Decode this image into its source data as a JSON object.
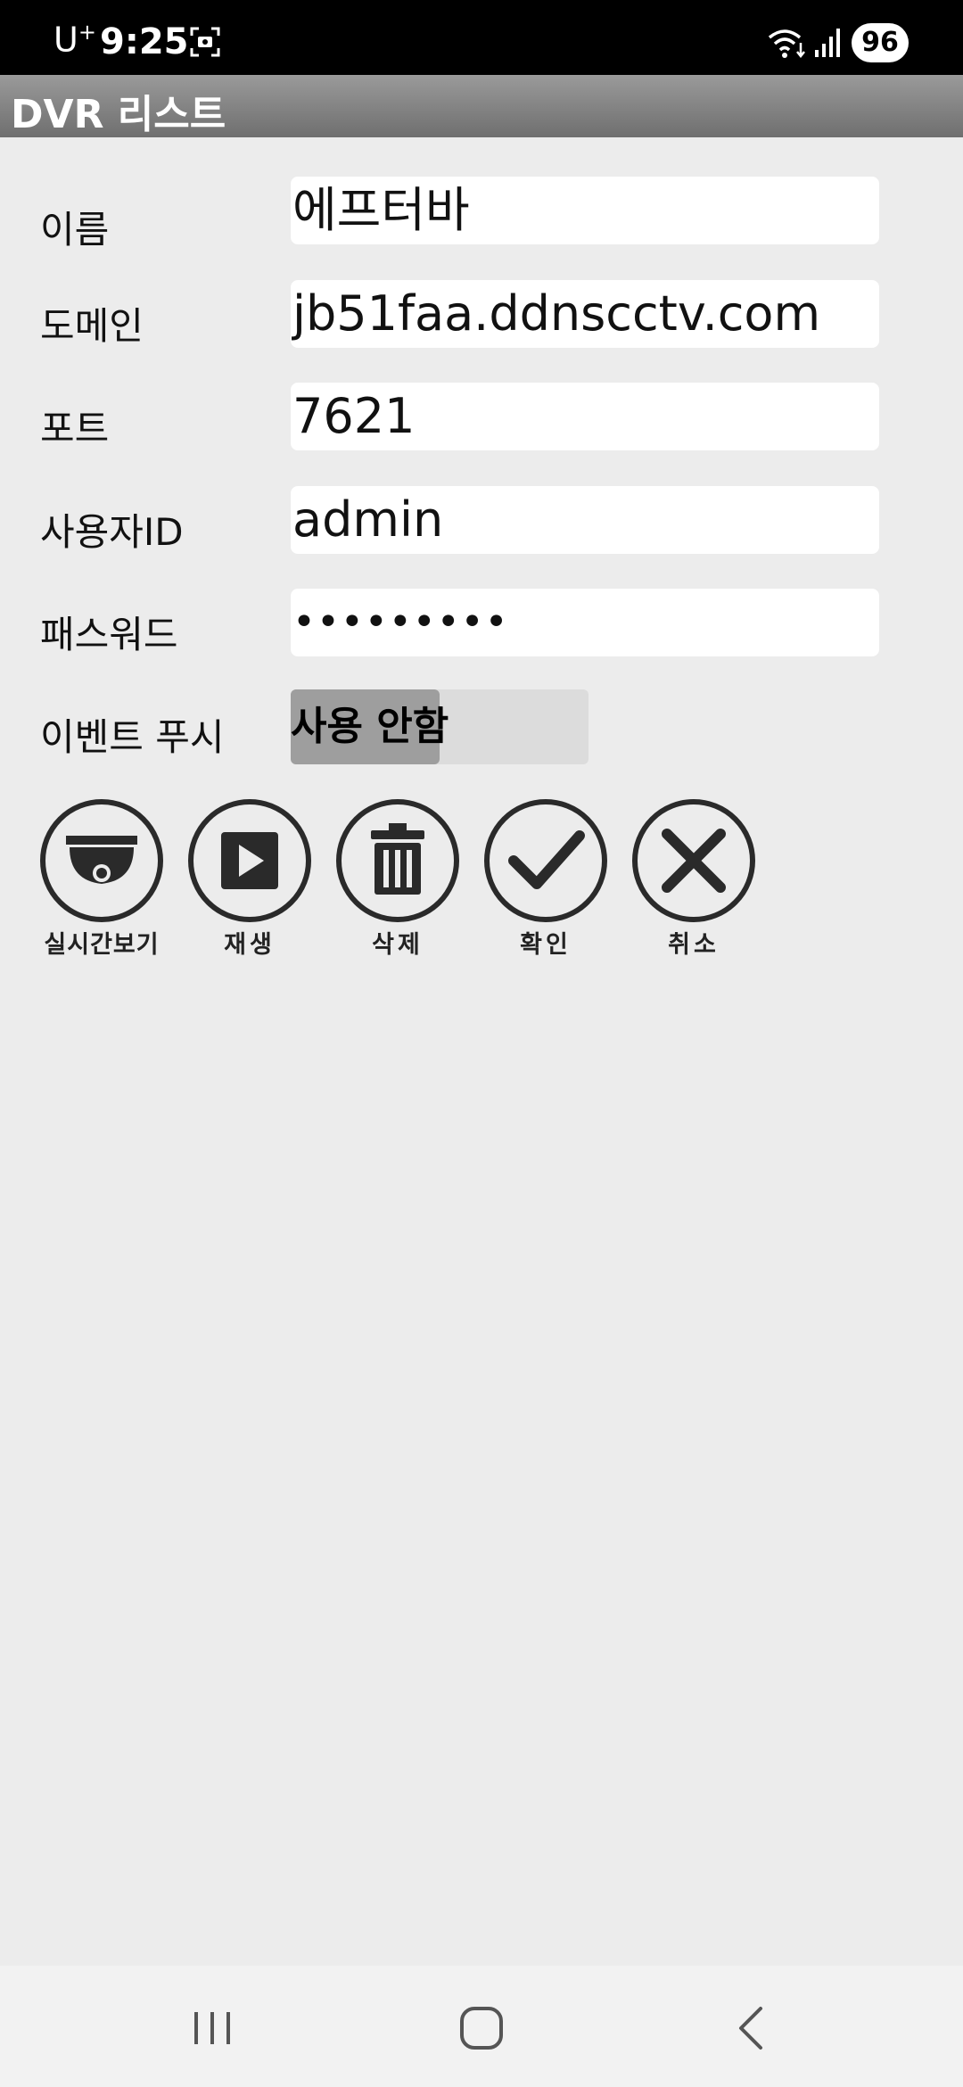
{
  "status_bar": {
    "carrier": "U",
    "carrier_sup": "+",
    "time": "9:25",
    "battery": "96",
    "icons": [
      "screenshot-icon",
      "wifi-icon",
      "signal-icon",
      "battery-icon"
    ]
  },
  "titlebar": {
    "title": "DVR 리스트"
  },
  "form": {
    "name_label": "이름",
    "name_value": "에프터바",
    "domain_label": "도메인",
    "domain_value": "jb51faa.ddnscctv.com",
    "port_label": "포트",
    "port_value": "7621",
    "userid_label": "사용자ID",
    "userid_value": "admin",
    "password_label": "패스워드",
    "password_value": "•••••••••",
    "push_label": "이벤트 푸시",
    "push_value": "사용 안함"
  },
  "actions": [
    {
      "label": "실시간보기",
      "icon": "dome-camera-icon"
    },
    {
      "label": "재생",
      "icon": "play-icon"
    },
    {
      "label": "삭제",
      "icon": "trash-icon"
    },
    {
      "label": "확인",
      "icon": "checkmark-icon"
    },
    {
      "label": "취소",
      "icon": "close-icon"
    }
  ],
  "navbar": {
    "icons": [
      "recent-apps-icon",
      "home-icon",
      "back-icon"
    ]
  },
  "colors": {
    "background": "#ececec",
    "titlebar_top": "#9a9a9a",
    "titlebar_bottom": "#6f6f6f",
    "toggle_track": "#dcdcdc",
    "toggle_knob": "#9e9e9e"
  }
}
